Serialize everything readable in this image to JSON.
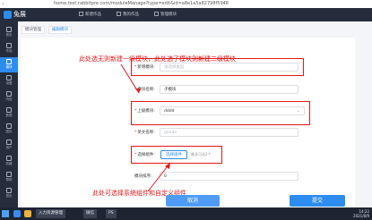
{
  "browser": {
    "url": "home.test.rabbitpre.com/moduleManage?type=edit&id=a8e1a5a82798f5948",
    "back_glyph": "‹"
  },
  "header": {
    "brand": "兔展",
    "nav": [
      {
        "label": "新建作品",
        "icon": "file-icon"
      },
      {
        "label": "我的作品",
        "icon": "folder-icon"
      },
      {
        "label": "管理模块",
        "icon": "grid-icon"
      }
    ]
  },
  "sidebar": {
    "items": [
      {
        "label": "首页",
        "icon": "home-icon",
        "active": false
      },
      {
        "label": "作品",
        "icon": "doc-icon",
        "active": false
      },
      {
        "label": "模块",
        "icon": "cube-icon",
        "active": true
      },
      {
        "label": "设置",
        "icon": "gear-icon",
        "active": false
      },
      {
        "label": "内容",
        "icon": "content-icon",
        "active": false
      },
      {
        "label": "数据",
        "icon": "chart-icon",
        "active": false
      },
      {
        "label": "团队",
        "icon": "team-icon",
        "active": false
      },
      {
        "label": "用户",
        "icon": "user-icon",
        "active": false
      },
      {
        "label": "收藏",
        "icon": "star-icon",
        "active": false
      },
      {
        "label": "帮助",
        "icon": "help-icon",
        "active": false
      },
      {
        "label": "退出",
        "icon": "exit-icon",
        "active": false
      }
    ]
  },
  "breadcrumbs": [
    {
      "label": "模块管理",
      "active": false
    },
    {
      "label": "编辑模块",
      "active": true
    }
  ],
  "form": {
    "new_module": {
      "label": "新增模块:",
      "placeholder": "请选择类型"
    },
    "module_name": {
      "label": "模块名称:",
      "value": "子模块"
    },
    "parent_module": {
      "label": "上级模块:",
      "value": "dddd"
    },
    "english_name": {
      "label": "英文名称:",
      "placeholder": "gonde"
    },
    "component": {
      "label": "选择组件:",
      "button": "选择组件",
      "hint": "最多可选2个"
    },
    "sort": {
      "label": "模块排序:",
      "value": "0"
    }
  },
  "annotations": {
    "top": "此处选无则新建一级模块，此处选了模块则新建二级模块",
    "bottom": "此处可选择系统组件和自定义组件"
  },
  "actions": {
    "cancel": "取消",
    "submit": "提交"
  },
  "taskbar": {
    "apps": [
      "入力资源管理",
      "微信",
      "PS"
    ],
    "time": "14:22",
    "date": "2021/8/9"
  },
  "colors": {
    "accent": "#2d8cf0",
    "annotation": "#e5191a",
    "sidebar": "#252c3b"
  }
}
